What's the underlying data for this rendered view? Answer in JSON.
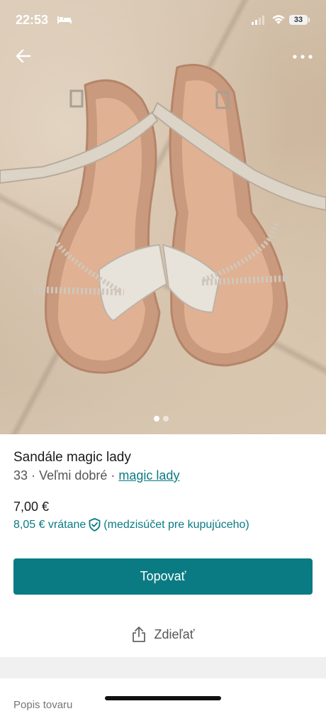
{
  "status_bar": {
    "time": "22:53",
    "battery": "33"
  },
  "gallery": {
    "image_count": 2,
    "active_index": 0
  },
  "item": {
    "title": "Sandále magic lady",
    "size": "33",
    "separator": "·",
    "condition": "Veľmi dobré",
    "brand": "magic lady",
    "price": "7,00 €",
    "price_incl_amount": "8,05 € vrátane",
    "price_incl_note": "(medzisúčet pre kupujúceho)"
  },
  "actions": {
    "bump_label": "Topovať",
    "share_label": "Zdieľať"
  },
  "description": {
    "label": "Popis tovaru"
  },
  "colors": {
    "accent": "#0a7b83"
  }
}
